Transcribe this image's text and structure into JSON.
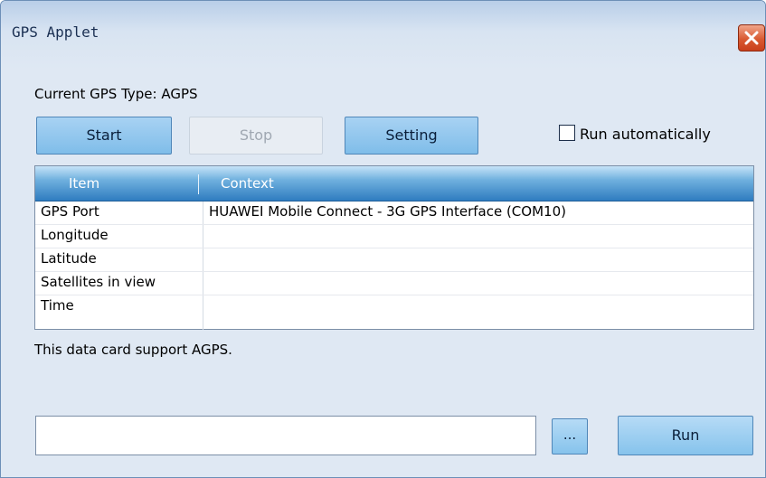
{
  "window": {
    "title": "GPS Applet"
  },
  "gps_type_label": "Current GPS Type: AGPS",
  "buttons": {
    "start": "Start",
    "stop": "Stop",
    "setting": "Setting",
    "browse": "...",
    "run": "Run"
  },
  "run_automatically": {
    "label": "Run automatically",
    "checked": false
  },
  "table": {
    "columns": [
      "Item",
      "Context"
    ],
    "rows": [
      {
        "item": "GPS Port",
        "context": "HUAWEI Mobile Connect - 3G GPS Interface (COM10)"
      },
      {
        "item": "Longitude",
        "context": ""
      },
      {
        "item": "Latitude",
        "context": ""
      },
      {
        "item": "Satellites in view",
        "context": ""
      },
      {
        "item": "Time",
        "context": ""
      }
    ]
  },
  "support_message": "This data card support AGPS.",
  "command_input": {
    "value": ""
  },
  "colors": {
    "window_bg": "#dfe8f3",
    "header_blue": "#2f7cc0",
    "button_blue": "#86c3ec",
    "close_red": "#d95a32"
  }
}
